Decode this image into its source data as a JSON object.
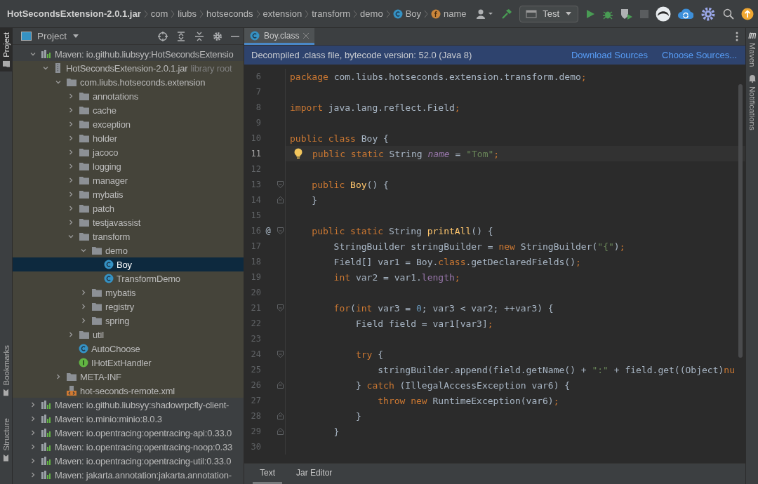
{
  "navigation_bar": {
    "breadcrumbs": [
      {
        "label": "HotSecondsExtension-2.0.1.jar",
        "kind": "root"
      },
      {
        "label": "com",
        "kind": "package"
      },
      {
        "label": "liubs",
        "kind": "package"
      },
      {
        "label": "hotseconds",
        "kind": "package"
      },
      {
        "label": "extension",
        "kind": "package"
      },
      {
        "label": "transform",
        "kind": "package"
      },
      {
        "label": "demo",
        "kind": "package"
      },
      {
        "label": "Boy",
        "kind": "class"
      },
      {
        "label": "name",
        "kind": "field"
      }
    ],
    "run_config": "Test"
  },
  "left_stripe": {
    "top": [
      {
        "label": "Project",
        "selected": true
      }
    ],
    "bottom": [
      {
        "label": "Bookmarks",
        "selected": false
      },
      {
        "label": "Structure",
        "selected": false
      }
    ]
  },
  "project_panel": {
    "title": "Project",
    "tree": [
      {
        "label": "Maven: io.github.liubsyy:HotSecondsExtensio",
        "kind": "library",
        "expanded": true,
        "selected": false,
        "children": [
          {
            "label": "HotSecondsExtension-2.0.1.jar",
            "hint": "library root",
            "kind": "jar",
            "expanded": true,
            "selected": false,
            "children": [
              {
                "label": "com.liubs.hotseconds.extension",
                "kind": "folder",
                "expanded": true,
                "selected": false,
                "children": [
                  {
                    "label": "annotations",
                    "kind": "folder",
                    "expanded": false,
                    "selected": false
                  },
                  {
                    "label": "cache",
                    "kind": "folder",
                    "expanded": false,
                    "selected": false
                  },
                  {
                    "label": "exception",
                    "kind": "folder",
                    "expanded": false,
                    "selected": false
                  },
                  {
                    "label": "holder",
                    "kind": "folder",
                    "expanded": false,
                    "selected": false
                  },
                  {
                    "label": "jacoco",
                    "kind": "folder",
                    "expanded": false,
                    "selected": false
                  },
                  {
                    "label": "logging",
                    "kind": "folder",
                    "expanded": false,
                    "selected": false
                  },
                  {
                    "label": "manager",
                    "kind": "folder",
                    "expanded": false,
                    "selected": false
                  },
                  {
                    "label": "mybatis",
                    "kind": "folder",
                    "expanded": false,
                    "selected": false
                  },
                  {
                    "label": "patch",
                    "kind": "folder",
                    "expanded": false,
                    "selected": false
                  },
                  {
                    "label": "testjavassist",
                    "kind": "folder",
                    "expanded": false,
                    "selected": false
                  },
                  {
                    "label": "transform",
                    "kind": "folder",
                    "expanded": true,
                    "selected": false,
                    "children": [
                      {
                        "label": "demo",
                        "kind": "folder",
                        "expanded": true,
                        "selected": false,
                        "children": [
                          {
                            "label": "Boy",
                            "kind": "class",
                            "selected": true
                          },
                          {
                            "label": "TransformDemo",
                            "kind": "class",
                            "selected": false
                          }
                        ]
                      },
                      {
                        "label": "mybatis",
                        "kind": "folder",
                        "expanded": false,
                        "selected": false
                      },
                      {
                        "label": "registry",
                        "kind": "folder",
                        "expanded": false,
                        "selected": false
                      },
                      {
                        "label": "spring",
                        "kind": "folder",
                        "expanded": false,
                        "selected": false
                      }
                    ]
                  },
                  {
                    "label": "util",
                    "kind": "folder",
                    "expanded": false,
                    "selected": false
                  },
                  {
                    "label": "AutoChoose",
                    "kind": "class",
                    "selected": false
                  },
                  {
                    "label": "IHotExtHandler",
                    "kind": "interface",
                    "selected": false
                  }
                ]
              },
              {
                "label": "META-INF",
                "kind": "folder",
                "expanded": false,
                "selected": false
              },
              {
                "label": "hot-seconds-remote.xml",
                "kind": "xml",
                "selected": false
              }
            ]
          }
        ]
      },
      {
        "label": "Maven: io.github.liubsyy:shadowrpcfly-client-",
        "kind": "library",
        "expanded": false,
        "selected": false
      },
      {
        "label": "Maven: io.minio:minio:8.0.3",
        "kind": "library",
        "expanded": false,
        "selected": false
      },
      {
        "label": "Maven: io.opentracing:opentracing-api:0.33.0",
        "kind": "library",
        "expanded": false,
        "selected": false
      },
      {
        "label": "Maven: io.opentracing:opentracing-noop:0.33",
        "kind": "library",
        "expanded": false,
        "selected": false
      },
      {
        "label": "Maven: io.opentracing:opentracing-util:0.33.0",
        "kind": "library",
        "expanded": false,
        "selected": false
      },
      {
        "label": "Maven: jakarta.annotation:jakarta.annotation-",
        "kind": "library",
        "expanded": false,
        "selected": false
      }
    ]
  },
  "editor": {
    "tabs": [
      {
        "label": "Boy.class",
        "selected": true
      }
    ],
    "banner": {
      "text": "Decompiled .class file, bytecode version: 52.0 (Java 8)",
      "links": [
        "Download Sources",
        "Choose Sources..."
      ]
    },
    "lines": [
      {
        "number": "6",
        "current": false,
        "tokens": [
          {
            "text": "package ",
            "kind": "kw"
          },
          {
            "text": "com.liubs.hotseconds.extension.transform.demo",
            "kind": "plain"
          },
          {
            "text": ";",
            "kind": "punct"
          }
        ]
      },
      {
        "number": "7",
        "current": false
      },
      {
        "number": "8",
        "current": false,
        "tokens": [
          {
            "text": "import ",
            "kind": "kw"
          },
          {
            "text": "java.lang.reflect.Field",
            "kind": "plain"
          },
          {
            "text": ";",
            "kind": "punct"
          }
        ]
      },
      {
        "number": "9",
        "current": false
      },
      {
        "number": "10",
        "current": false,
        "tokens": [
          {
            "text": "public class ",
            "kind": "kw"
          },
          {
            "text": "Boy {",
            "kind": "plain"
          }
        ]
      },
      {
        "number": "11",
        "current": true,
        "tokens": [
          {
            "text": "public static ",
            "kind": "kw"
          },
          {
            "text": "String ",
            "kind": "plain"
          },
          {
            "text": "name",
            "kind": "field"
          },
          {
            "text": " = ",
            "kind": "plain"
          },
          {
            "text": "\"Tom\"",
            "kind": "str"
          },
          {
            "text": ";",
            "kind": "punct"
          }
        ]
      },
      {
        "number": "12",
        "current": false
      },
      {
        "number": "13",
        "current": false,
        "fold": {
          "kind": "start"
        },
        "tokens": [
          {
            "text": "    public ",
            "kind": "kw"
          },
          {
            "text": "Boy",
            "kind": "decl"
          },
          {
            "text": "() {",
            "kind": "plain"
          }
        ]
      },
      {
        "number": "14",
        "current": false,
        "fold": {
          "kind": "end"
        },
        "tokens": [
          {
            "text": "    }",
            "kind": "plain"
          }
        ]
      },
      {
        "number": "15",
        "current": false
      },
      {
        "number": "16",
        "current": false,
        "gutter": "@",
        "fold": {
          "kind": "start"
        },
        "tokens": [
          {
            "text": "    public static ",
            "kind": "kw"
          },
          {
            "text": "String ",
            "kind": "plain"
          },
          {
            "text": "printAll",
            "kind": "decl"
          },
          {
            "text": "() {",
            "kind": "plain"
          }
        ]
      },
      {
        "number": "17",
        "current": false,
        "tokens": [
          {
            "text": "        StringBuilder stringBuilder = ",
            "kind": "plain"
          },
          {
            "text": "new ",
            "kind": "kw"
          },
          {
            "text": "StringBuilder(",
            "kind": "plain"
          },
          {
            "text": "\"{\"",
            "kind": "str"
          },
          {
            "text": ")",
            "kind": "plain"
          },
          {
            "text": ";",
            "kind": "punct"
          }
        ]
      },
      {
        "number": "18",
        "current": false,
        "tokens": [
          {
            "text": "        Field[] var1 = Boy.",
            "kind": "plain"
          },
          {
            "text": "class",
            "kind": "kw"
          },
          {
            "text": ".getDeclaredFields()",
            "kind": "plain"
          },
          {
            "text": ";",
            "kind": "punct"
          }
        ]
      },
      {
        "number": "19",
        "current": false,
        "tokens": [
          {
            "text": "        int ",
            "kind": "kw"
          },
          {
            "text": "var2 = var1.",
            "kind": "plain"
          },
          {
            "text": "length",
            "kind": "member"
          },
          {
            "text": ";",
            "kind": "punct"
          }
        ]
      },
      {
        "number": "20",
        "current": false
      },
      {
        "number": "21",
        "current": false,
        "fold": {
          "kind": "start"
        },
        "tokens": [
          {
            "text": "        for",
            "kind": "kw"
          },
          {
            "text": "(",
            "kind": "plain"
          },
          {
            "text": "int ",
            "kind": "kw"
          },
          {
            "text": "var3 = ",
            "kind": "plain"
          },
          {
            "text": "0",
            "kind": "num"
          },
          {
            "text": "; var3 < var2; ++var3) {",
            "kind": "plain"
          }
        ]
      },
      {
        "number": "22",
        "current": false,
        "tokens": [
          {
            "text": "            Field field = var1[var3]",
            "kind": "plain"
          },
          {
            "text": ";",
            "kind": "punct"
          }
        ]
      },
      {
        "number": "23",
        "current": false
      },
      {
        "number": "24",
        "current": false,
        "fold": {
          "kind": "start"
        },
        "tokens": [
          {
            "text": "            try ",
            "kind": "kw"
          },
          {
            "text": "{",
            "kind": "plain"
          }
        ]
      },
      {
        "number": "25",
        "current": false,
        "tokens": [
          {
            "text": "                stringBuilder.append(field.getName() + ",
            "kind": "plain"
          },
          {
            "text": "\":\"",
            "kind": "str"
          },
          {
            "text": " + field.get((Object)",
            "kind": "plain"
          },
          {
            "text": "nu",
            "kind": "kw"
          }
        ]
      },
      {
        "number": "26",
        "current": false,
        "fold": {
          "kind": "end"
        },
        "tokens": [
          {
            "text": "            } ",
            "kind": "plain"
          },
          {
            "text": "catch ",
            "kind": "kw"
          },
          {
            "text": "(IllegalAccessException var6) {",
            "kind": "plain"
          }
        ]
      },
      {
        "number": "27",
        "current": false,
        "tokens": [
          {
            "text": "                throw new ",
            "kind": "kw"
          },
          {
            "text": "RuntimeException(var6)",
            "kind": "plain"
          },
          {
            "text": ";",
            "kind": "punct"
          }
        ]
      },
      {
        "number": "28",
        "current": false,
        "fold": {
          "kind": "end"
        },
        "tokens": [
          {
            "text": "            }",
            "kind": "plain"
          }
        ]
      },
      {
        "number": "29",
        "current": false,
        "fold": {
          "kind": "end"
        },
        "tokens": [
          {
            "text": "        }",
            "kind": "plain"
          }
        ]
      },
      {
        "number": "30",
        "current": false
      }
    ],
    "bottom_tabs": [
      {
        "label": "Text",
        "selected": true
      },
      {
        "label": "Jar Editor",
        "selected": false
      }
    ]
  },
  "right_stripe": [
    {
      "label": "Maven",
      "kind": "maven"
    },
    {
      "label": "Notifications",
      "kind": "notifications"
    }
  ]
}
